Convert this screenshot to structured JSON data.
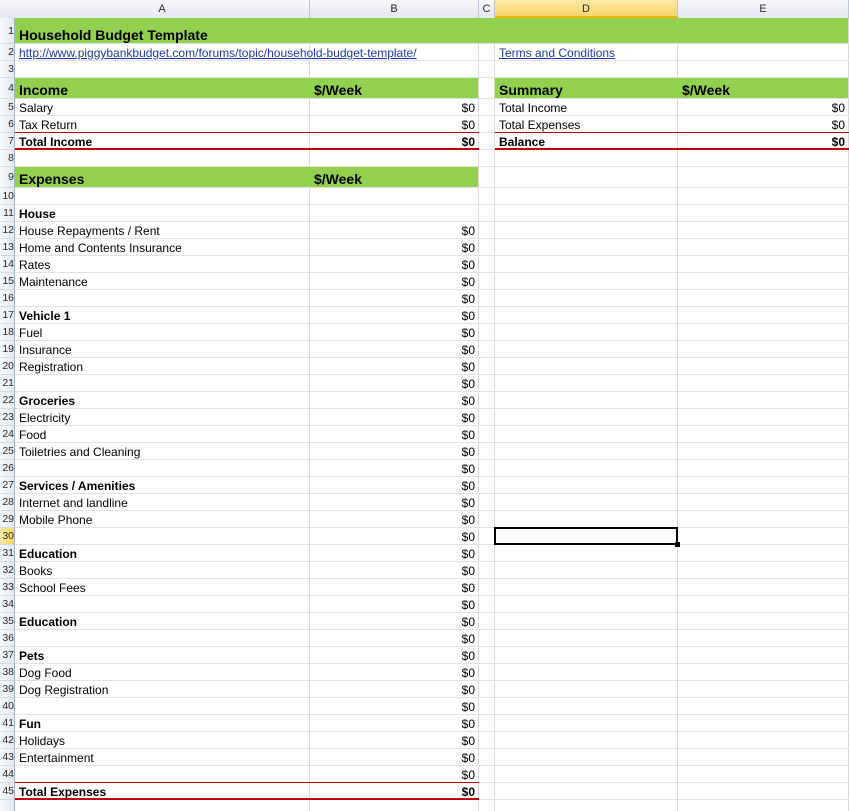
{
  "columns": [
    "A",
    "B",
    "C",
    "D",
    "E"
  ],
  "rows": [
    "1",
    "2",
    "3",
    "4",
    "5",
    "6",
    "7",
    "8",
    "9",
    "10",
    "11",
    "12",
    "13",
    "14",
    "15",
    "16",
    "17",
    "18",
    "19",
    "20",
    "21",
    "22",
    "23",
    "24",
    "25",
    "26",
    "27",
    "28",
    "29",
    "30",
    "31",
    "32",
    "33",
    "34",
    "35",
    "36",
    "37",
    "38",
    "39",
    "40",
    "41",
    "42",
    "43",
    "44",
    "45"
  ],
  "selected": {
    "column": "D",
    "row": "30"
  },
  "title": "Household Budget Template",
  "url": "http://www.piggybankbudget.com/forums/topic/household-budget-template/",
  "terms": "Terms and Conditions",
  "income": {
    "header": "Income",
    "col_label": "$/Week",
    "items": [
      {
        "label": "Salary",
        "value": "$0"
      },
      {
        "label": "Tax Return",
        "value": "$0"
      }
    ],
    "total_label": "Total Income",
    "total_value": "$0"
  },
  "summary": {
    "header": "Summary",
    "col_label": "$/Week",
    "items": [
      {
        "label": "Total Income",
        "value": "$0"
      },
      {
        "label": "Total Expenses",
        "value": "$0"
      }
    ],
    "balance_label": "Balance",
    "balance_value": "$0"
  },
  "expenses": {
    "header": "Expenses",
    "col_label": "$/Week",
    "rows": [
      {
        "label": "House",
        "bold": true,
        "value": ""
      },
      {
        "label": "House Repayments / Rent",
        "value": "$0"
      },
      {
        "label": "Home and Contents Insurance",
        "value": "$0"
      },
      {
        "label": "Rates",
        "value": "$0"
      },
      {
        "label": "Maintenance",
        "value": "$0"
      },
      {
        "label": "",
        "value": "$0"
      },
      {
        "label": "Vehicle 1",
        "bold": true,
        "value": "$0"
      },
      {
        "label": "Fuel",
        "value": "$0"
      },
      {
        "label": "Insurance",
        "value": "$0"
      },
      {
        "label": "Registration",
        "value": "$0"
      },
      {
        "label": "",
        "value": "$0"
      },
      {
        "label": "Groceries",
        "bold": true,
        "value": "$0"
      },
      {
        "label": "Electricity",
        "value": "$0"
      },
      {
        "label": "Food",
        "value": "$0"
      },
      {
        "label": "Toiletries and Cleaning",
        "value": "$0"
      },
      {
        "label": "",
        "value": "$0"
      },
      {
        "label": "Services / Amenities",
        "bold": true,
        "value": "$0"
      },
      {
        "label": "Internet and landline",
        "value": "$0"
      },
      {
        "label": "Mobile Phone",
        "value": "$0"
      },
      {
        "label": "",
        "value": "$0"
      },
      {
        "label": "Education",
        "bold": true,
        "value": "$0"
      },
      {
        "label": "Books",
        "value": "$0"
      },
      {
        "label": "School Fees",
        "value": "$0"
      },
      {
        "label": "",
        "value": "$0"
      },
      {
        "label": "Education",
        "bold": true,
        "value": "$0"
      },
      {
        "label": "",
        "value": "$0"
      },
      {
        "label": "Pets",
        "bold": true,
        "value": "$0"
      },
      {
        "label": "Dog Food",
        "value": "$0"
      },
      {
        "label": "Dog Registration",
        "value": "$0"
      },
      {
        "label": "",
        "value": "$0"
      },
      {
        "label": "Fun",
        "bold": true,
        "value": "$0"
      },
      {
        "label": "Holidays",
        "value": "$0"
      },
      {
        "label": "Entertainment",
        "value": "$0"
      },
      {
        "label": "",
        "value": "$0"
      }
    ],
    "total_label": "Total Expenses",
    "total_value": "$0"
  },
  "colors": {
    "header_fill": "#92d050",
    "total_rule": "#c00000",
    "link": "#1f3aa6",
    "selection_header": "#f9d66a"
  }
}
